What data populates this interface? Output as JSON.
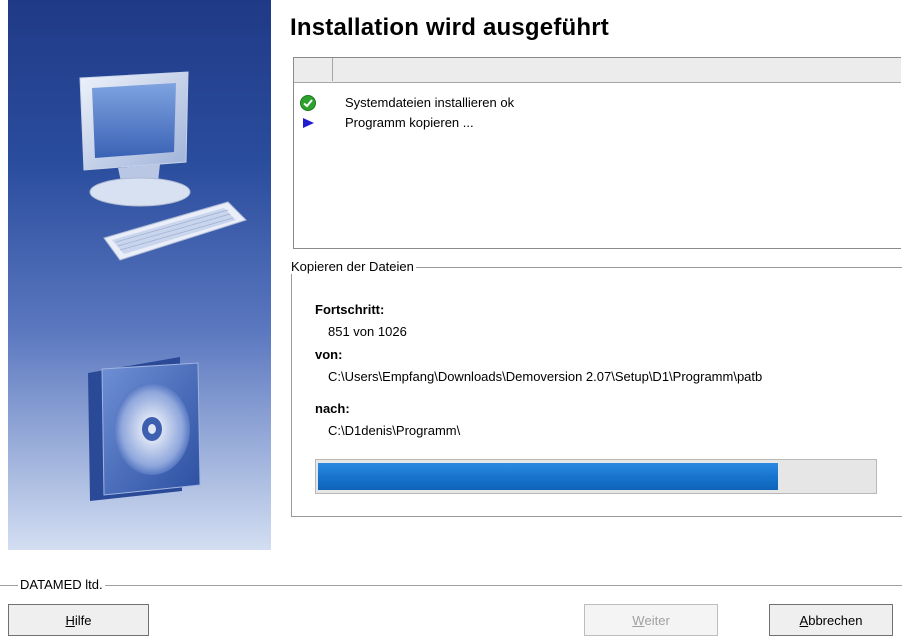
{
  "title": "Installation wird ausgeführt",
  "tasks": [
    {
      "status": "done",
      "icon": "check-icon",
      "text": "Systemdateien installieren ok"
    },
    {
      "status": "running",
      "icon": "arrow-right-icon",
      "text": "Programm kopieren ..."
    }
  ],
  "copy": {
    "group_label": "Kopieren der Dateien",
    "progress_label": "Fortschritt:",
    "progress_value": "851 von 1026",
    "from_label": "von:",
    "from_value": "C:\\Users\\Empfang\\Downloads\\Demoversion 2.07\\Setup\\D1\\Programm\\patb",
    "to_label": "nach:",
    "to_value": "C:\\D1denis\\Programm\\",
    "progress_fraction": 0.829
  },
  "footer": {
    "brand": "DATAMED ltd.",
    "help_accel": "H",
    "help_rest": "ilfe",
    "next_accel": "W",
    "next_rest": "eiter",
    "cancel_accel": "A",
    "cancel_rest": "bbrechen"
  },
  "colors": {
    "progress": "#1673cc",
    "check": "#2da12d",
    "arrow": "#1f1fd0"
  }
}
